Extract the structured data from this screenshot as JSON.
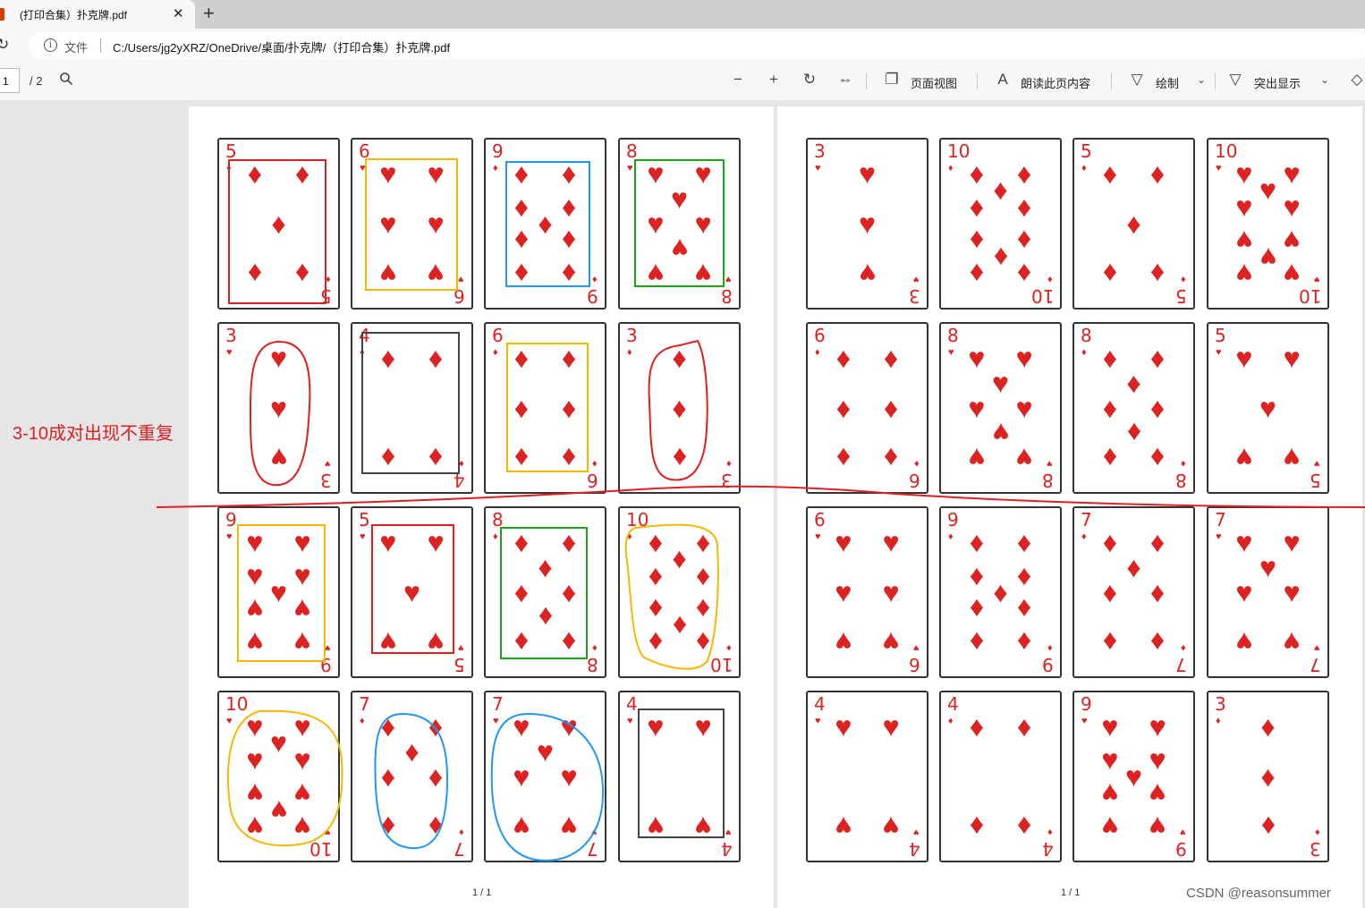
{
  "tab": {
    "title": "(打印合集）扑克牌.pdf",
    "close": "✕",
    "new_tab": "+"
  },
  "address": {
    "file_label": "文件",
    "url": "C:/Users/jg2yXRZ/OneDrive/桌面/扑克牌/（打印合集）扑克牌.pdf"
  },
  "toolbar": {
    "page_current": "1",
    "page_total": "/ 2",
    "page_view": "页面视图",
    "read_aloud": "朗读此页内容",
    "draw": "绘制",
    "highlight": "突出显示"
  },
  "icons": {
    "refresh": "refresh-icon",
    "info": "info-icon",
    "search": "search-icon",
    "zoom_out": "zoom-out-icon",
    "zoom_in": "zoom-in-icon",
    "rotate": "rotate-icon",
    "fit": "fit-width-icon",
    "page_view": "page-view-icon",
    "read_aloud": "read-aloud-icon",
    "draw": "draw-icon",
    "highlight": "highlight-icon",
    "eraser": "eraser-icon"
  },
  "page1": {
    "page_number": "1 / 1",
    "cards": [
      {
        "rank": "5",
        "suit": "♦"
      },
      {
        "rank": "6",
        "suit": "♥"
      },
      {
        "rank": "9",
        "suit": "♦"
      },
      {
        "rank": "8",
        "suit": "♥"
      },
      {
        "rank": "3",
        "suit": "♥"
      },
      {
        "rank": "4",
        "suit": "♦"
      },
      {
        "rank": "6",
        "suit": "♦"
      },
      {
        "rank": "3",
        "suit": "♦"
      },
      {
        "rank": "9",
        "suit": "♥"
      },
      {
        "rank": "5",
        "suit": "♥"
      },
      {
        "rank": "8",
        "suit": "♦"
      },
      {
        "rank": "10",
        "suit": "♦"
      },
      {
        "rank": "10",
        "suit": "♥"
      },
      {
        "rank": "7",
        "suit": "♦"
      },
      {
        "rank": "7",
        "suit": "♥"
      },
      {
        "rank": "4",
        "suit": "♥"
      }
    ]
  },
  "page2": {
    "page_number": "1 / 1",
    "cards": [
      {
        "rank": "3",
        "suit": "♥"
      },
      {
        "rank": "10",
        "suit": "♦"
      },
      {
        "rank": "5",
        "suit": "♦"
      },
      {
        "rank": "10",
        "suit": "♥"
      },
      {
        "rank": "6",
        "suit": "♦"
      },
      {
        "rank": "8",
        "suit": "♥"
      },
      {
        "rank": "8",
        "suit": "♦"
      },
      {
        "rank": "5",
        "suit": "♥"
      },
      {
        "rank": "6",
        "suit": "♥"
      },
      {
        "rank": "9",
        "suit": "♦"
      },
      {
        "rank": "7",
        "suit": "♦"
      },
      {
        "rank": "7",
        "suit": "♥"
      },
      {
        "rank": "4",
        "suit": "♥"
      },
      {
        "rank": "4",
        "suit": "♦"
      },
      {
        "rank": "9",
        "suit": "♥"
      },
      {
        "rank": "3",
        "suit": "♦"
      }
    ]
  },
  "annotation": {
    "text": "3-10成对出现不重复",
    "color": "#e02020"
  },
  "highlight_colors": {
    "red": "#e02020",
    "yellow": "#f5b800",
    "blue": "#2196f3",
    "green": "#1aa31a",
    "gray": "#444444"
  },
  "watermark": "CSDN @reasonsummer"
}
